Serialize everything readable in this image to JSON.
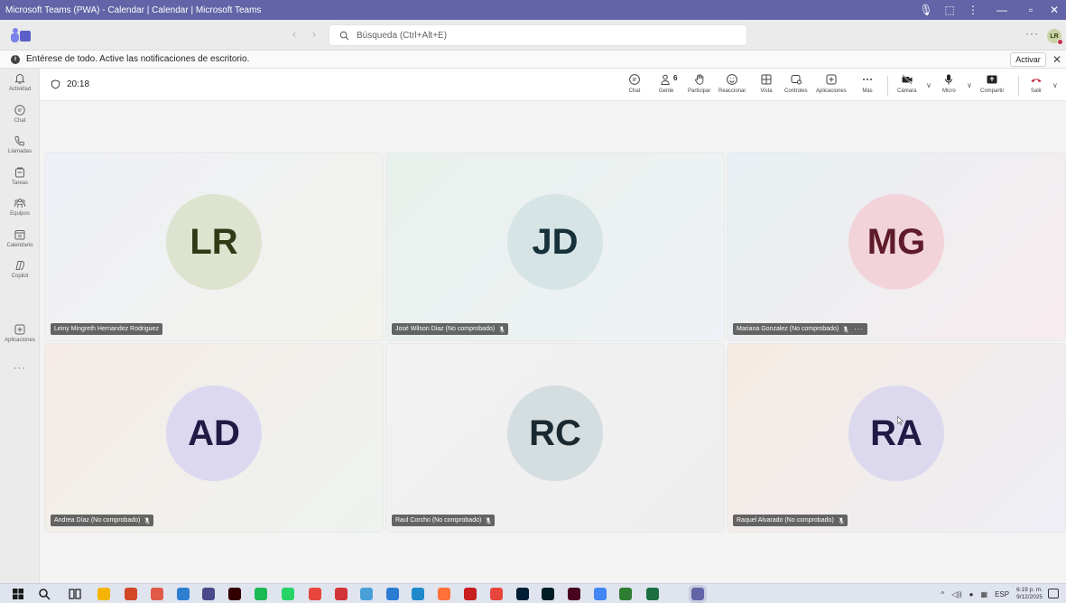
{
  "window": {
    "title": "Microsoft Teams (PWA) - Calendar | Calendar | Microsoft Teams"
  },
  "appbar": {
    "search_placeholder": "Búsqueda (Ctrl+Alt+E)",
    "more": "···",
    "avatar_initials": "LR"
  },
  "banner": {
    "text": "Entérese de todo. Active las notificaciones de escritorio.",
    "activate_label": "Activar",
    "close": "✕"
  },
  "rail": {
    "items": [
      {
        "label": "Actividad",
        "icon": "bell-icon"
      },
      {
        "label": "Chat",
        "icon": "chat-icon"
      },
      {
        "label": "Llamadas",
        "icon": "phone-icon"
      },
      {
        "label": "Tareas",
        "icon": "tasks-icon"
      },
      {
        "label": "Equipos",
        "icon": "teams-icon"
      },
      {
        "label": "Calendario",
        "icon": "calendar-icon"
      },
      {
        "label": "Copilot",
        "icon": "copilot-icon"
      },
      {
        "label": "Aplicaciones",
        "icon": "apps-icon"
      }
    ],
    "more": "···"
  },
  "meeting": {
    "timer": "20:18",
    "controls": {
      "chat": "Chat",
      "people": "Gente",
      "people_count": "6",
      "raise": "Participar",
      "react": "Reaccionar",
      "view": "Vista",
      "controls": "Controles",
      "apps": "Aplicaciones",
      "more": "Más",
      "camera": "Cámara",
      "mic": "Micro",
      "share": "Compartir",
      "leave": "Salir"
    }
  },
  "participants": [
    {
      "initials": "LR",
      "name": "Leiny Mingreth Hernandez Rodriguez",
      "circle": "#dde3cf",
      "text": "#2f3a16",
      "muted": false,
      "more": false
    },
    {
      "initials": "JD",
      "name": "José Wilson Diaz (No comprobado)",
      "circle": "#d6e4e6",
      "text": "#17313a",
      "muted": true,
      "more": false
    },
    {
      "initials": "MG",
      "name": "Mariana Gonzalez (No comprobado)",
      "circle": "#f3d3da",
      "text": "#5f1b2b",
      "muted": true,
      "more": true
    },
    {
      "initials": "AD",
      "name": "Andrea Díaz (No comprobado)",
      "circle": "#dcd8f0",
      "text": "#1f1b45",
      "muted": true,
      "more": false
    },
    {
      "initials": "RC",
      "name": "Raul Corcho (No comprobado)",
      "circle": "#d4dde0",
      "text": "#1b2a30",
      "muted": true,
      "more": false
    },
    {
      "initials": "RA",
      "name": "Raquel Alvarado (No comprobado)",
      "circle": "#dcd9ef",
      "text": "#1f1b45",
      "muted": true,
      "more": false
    }
  ],
  "taskbar": {
    "language": "ESP",
    "time": "6:19 p. m.",
    "date": "9/12/2025"
  }
}
